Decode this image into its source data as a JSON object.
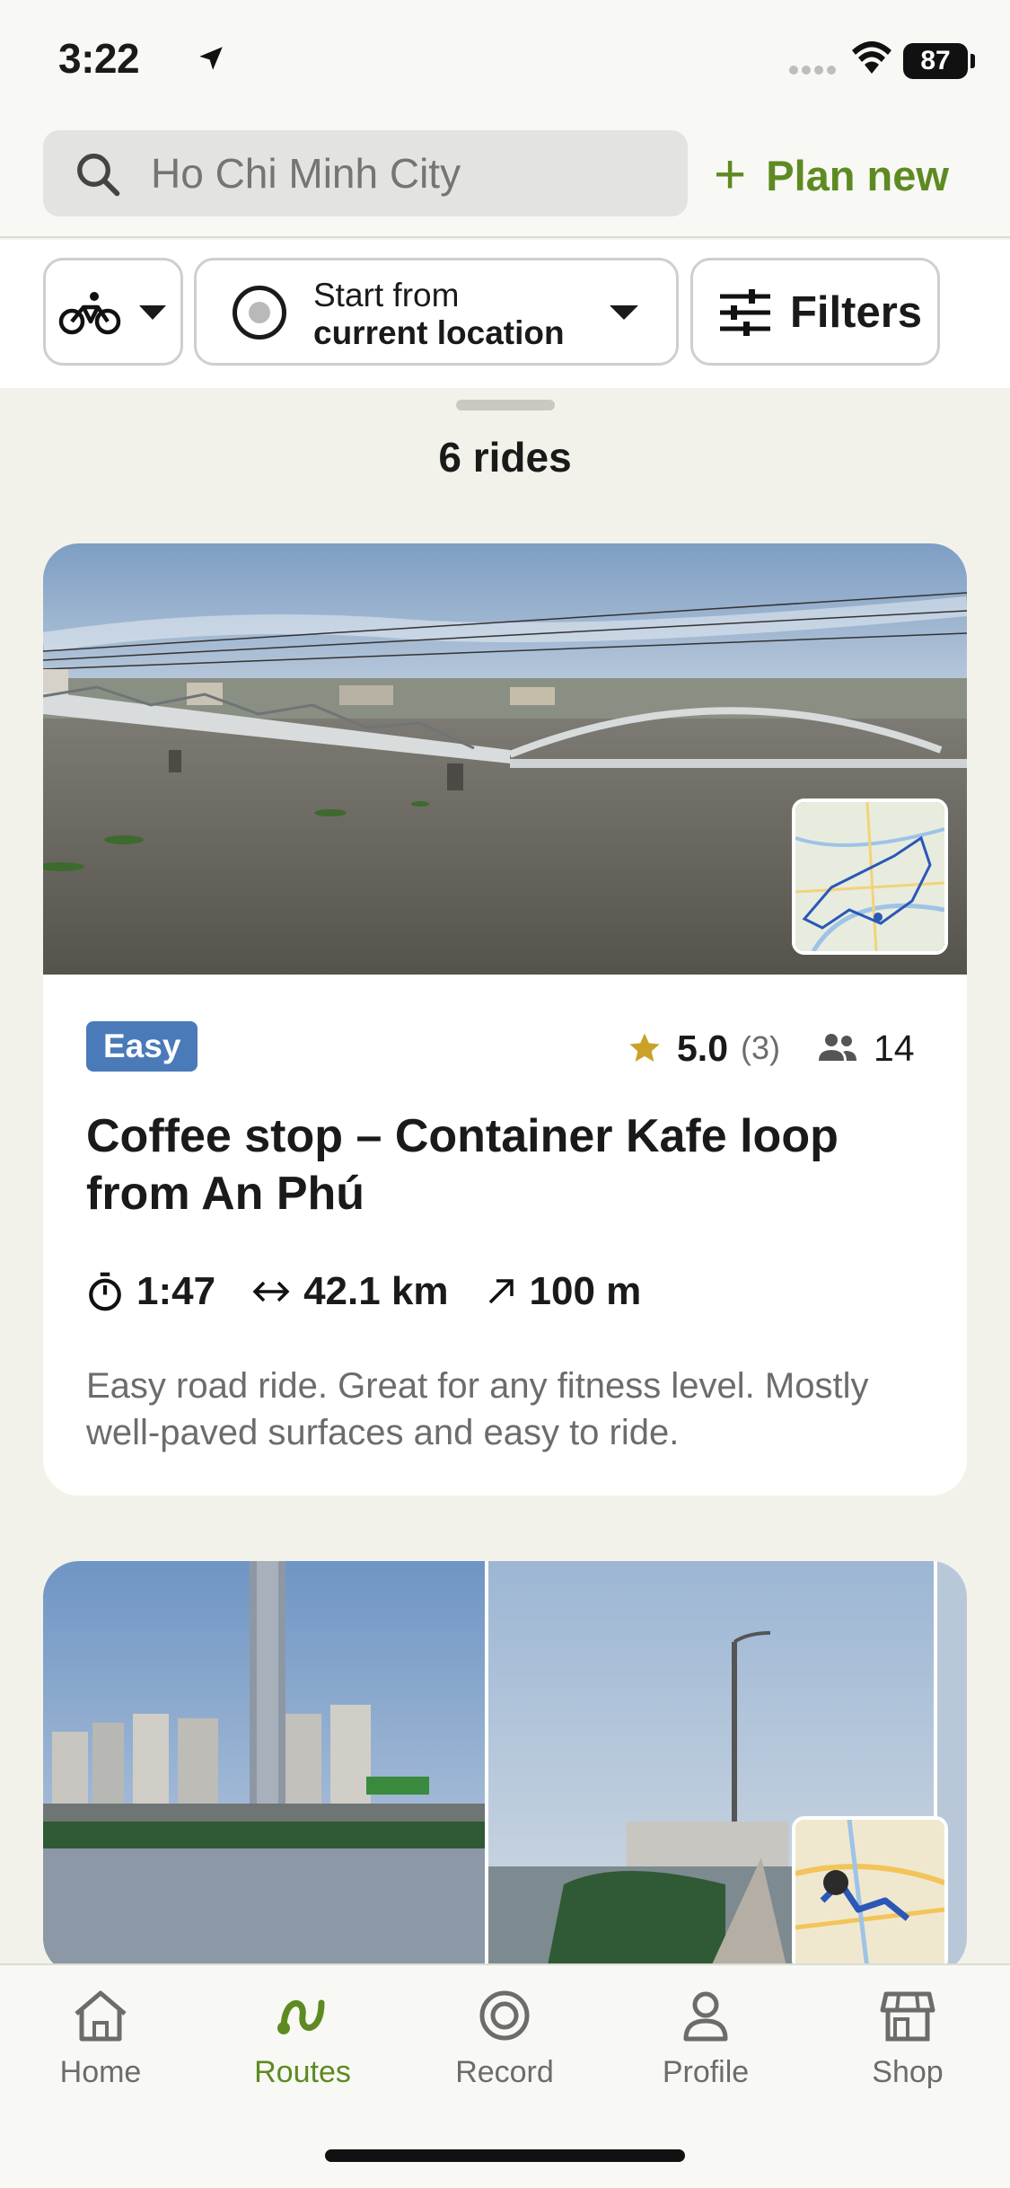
{
  "status_bar": {
    "time": "3:22",
    "battery": "87"
  },
  "search": {
    "placeholder": "Ho Chi Minh City",
    "value": ""
  },
  "plan_new": {
    "icon": "plus-icon",
    "label": "Plan new"
  },
  "filters": {
    "sport_icon": "road-bike-icon",
    "start_line1": "Start from",
    "start_line2": "current location",
    "filters_label": "Filters"
  },
  "rides_count": "6 rides",
  "rides": [
    {
      "difficulty": "Easy",
      "rating": "5.0",
      "rating_count": "(3)",
      "riders": "14",
      "title": "Coffee stop – Container Kafe loop from An Phú",
      "duration": "1:47",
      "distance": "42.1 km",
      "elevation": "100 m",
      "description": "Easy road ride. Great for any fitness level. Mostly well-paved surfaces and easy to ride."
    }
  ],
  "nav": {
    "items": [
      {
        "label": "Home",
        "icon": "home-icon"
      },
      {
        "label": "Routes",
        "icon": "routes-icon",
        "active": true
      },
      {
        "label": "Record",
        "icon": "record-icon"
      },
      {
        "label": "Profile",
        "icon": "profile-icon"
      },
      {
        "label": "Shop",
        "icon": "shop-icon"
      }
    ]
  },
  "colors": {
    "accent": "#5e8a22",
    "badge": "#4a7ab8",
    "star": "#c9a227",
    "background": "#f3f2ea"
  }
}
